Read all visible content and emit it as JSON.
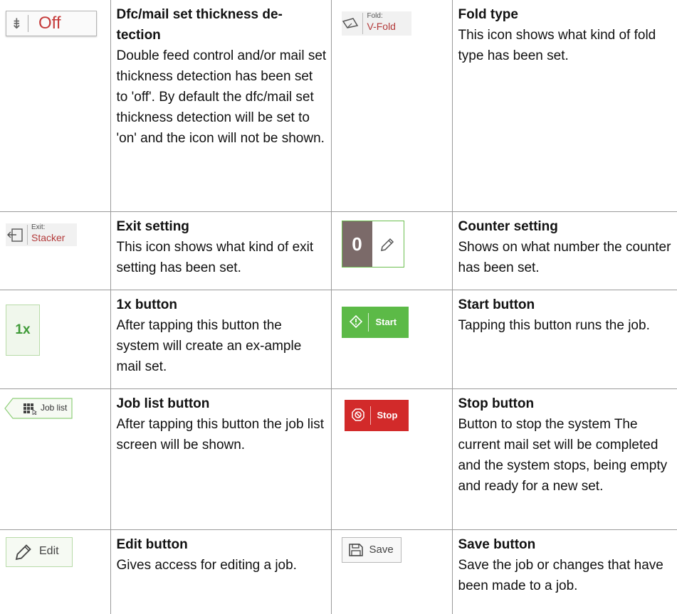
{
  "rows": [
    {
      "left": {
        "icon": {
          "kind": "dfc-off-icon",
          "label": "Off"
        },
        "title": "Dfc/mail set thickness de-tection",
        "text": "Double feed control and/or mail set thickness detection has been set to 'off'. By default the dfc/mail set thickness detection will be set to 'on' and the icon will not be shown."
      },
      "right": {
        "icon": {
          "kind": "fold-icon",
          "caption": "Fold:",
          "value": "V-Fold"
        },
        "title": "Fold type",
        "text": "This icon shows what kind of fold type has been set."
      }
    },
    {
      "left": {
        "icon": {
          "kind": "exit-icon",
          "caption": "Exit:",
          "value": "Stacker"
        },
        "title": "Exit setting",
        "text": "This icon shows what kind of exit setting has been set."
      },
      "right": {
        "icon": {
          "kind": "pencil-icon",
          "value": "0"
        },
        "title": "Counter setting",
        "text": "Shows on what number the counter has been set."
      }
    },
    {
      "left": {
        "icon": {
          "kind": "none",
          "label": "1x"
        },
        "title": "1x button",
        "text": "After tapping this button the system will create an ex-ample mail set."
      },
      "right": {
        "icon": {
          "kind": "start-icon",
          "label": "Start"
        },
        "title": "Start button",
        "text": "Tapping this button runs the job."
      }
    },
    {
      "left": {
        "icon": {
          "kind": "job-list-icon",
          "label": "Job list"
        },
        "title": "Job list button",
        "text": "After tapping this button the job list screen will be shown."
      },
      "right": {
        "icon": {
          "kind": "stop-icon",
          "label": "Stop"
        },
        "title": "Stop button",
        "text": "Button to stop the system The current mail set will be completed and the system stops, being empty and ready for a new set."
      }
    },
    {
      "left": {
        "icon": {
          "kind": "pencil-icon",
          "label": "Edit"
        },
        "title": "Edit button",
        "text": "Gives access for editing a job."
      },
      "right": {
        "icon": {
          "kind": "save-icon",
          "label": "Save"
        },
        "title": "Save button",
        "text": "Save the job or changes that have been made to a job."
      }
    }
  ],
  "colors": {
    "accent_green": "#5cba47",
    "stop_red": "#d22a2a",
    "value_red": "#b33a3a",
    "counter_bg": "#7b6a69"
  }
}
